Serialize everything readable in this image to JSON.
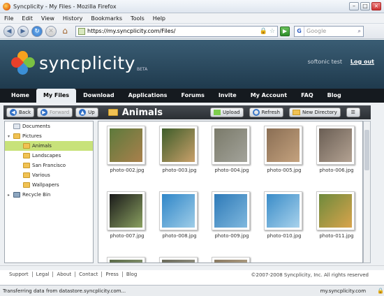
{
  "window": {
    "title": "Syncplicity - My Files - Mozilla Firefox"
  },
  "menu": [
    "File",
    "Edit",
    "View",
    "History",
    "Bookmarks",
    "Tools",
    "Help"
  ],
  "nav": {
    "url": "https://my.syncplicity.com/Files/",
    "search_placeholder": "Google",
    "search_engine": "G"
  },
  "brand": {
    "name": "syncplicity",
    "beta": "BETA",
    "user": "softonic test",
    "logout": "Log out"
  },
  "tabs": [
    "Home",
    "My Files",
    "Download",
    "Applications",
    "Forums",
    "Invite",
    "My Account",
    "FAQ",
    "Blog"
  ],
  "toolbar": {
    "back": "Back",
    "forward": "Forward",
    "up": "Up",
    "folder": "Animals",
    "upload": "Upload",
    "refresh": "Refresh",
    "new_dir": "New Directory"
  },
  "tree": [
    {
      "label": "Documents",
      "indent": 0,
      "type": "doc"
    },
    {
      "label": "Pictures",
      "indent": 0,
      "type": "folder",
      "expanded": true
    },
    {
      "label": "Animals",
      "indent": 1,
      "type": "folder",
      "selected": true
    },
    {
      "label": "Landscapes",
      "indent": 1,
      "type": "folder"
    },
    {
      "label": "San Francisco",
      "indent": 1,
      "type": "folder"
    },
    {
      "label": "Various",
      "indent": 1,
      "type": "folder"
    },
    {
      "label": "Wallpapers",
      "indent": 1,
      "type": "folder"
    },
    {
      "label": "Recycle Bin",
      "indent": 0,
      "type": "bin"
    }
  ],
  "files": [
    {
      "name": "photo-002.jpg",
      "colors": [
        "#5d7a3c",
        "#a9804c"
      ]
    },
    {
      "name": "photo-003.jpg",
      "colors": [
        "#3e5d2a",
        "#c9a06a"
      ]
    },
    {
      "name": "photo-004.jpg",
      "colors": [
        "#7a7a6a",
        "#a3a39a"
      ]
    },
    {
      "name": "photo-005.jpg",
      "colors": [
        "#8a6e54",
        "#c4a27e"
      ]
    },
    {
      "name": "photo-006.jpg",
      "colors": [
        "#6a5e54",
        "#b3a292"
      ]
    },
    {
      "name": "photo-007.jpg",
      "colors": [
        "#1a1a1a",
        "#8aa060"
      ]
    },
    {
      "name": "photo-008.jpg",
      "colors": [
        "#2f86c8",
        "#9fcde8"
      ]
    },
    {
      "name": "photo-009.jpg",
      "colors": [
        "#2e7ab8",
        "#7fb8de"
      ]
    },
    {
      "name": "photo-010.jpg",
      "colors": [
        "#3a8cc8",
        "#a8d2ec"
      ]
    },
    {
      "name": "photo-011.jpg",
      "colors": [
        "#6e8a3c",
        "#d9a44c"
      ]
    },
    {
      "name": "",
      "colors": [
        "#5a6a48",
        "#9aa882"
      ]
    },
    {
      "name": "",
      "colors": [
        "#6a6a5a",
        "#a8a698"
      ]
    },
    {
      "name": "",
      "colors": [
        "#8a7a62",
        "#c4b296"
      ]
    }
  ],
  "footer": {
    "links": [
      "Support",
      "Legal",
      "About",
      "Contact",
      "Press",
      "Blog"
    ],
    "copyright": "©2007-2008 Syncplicity, Inc. All rights reserved"
  },
  "status": {
    "text": "Transferring data from datastore.syncplicity.com...",
    "host": "my.syncplicity.com"
  }
}
